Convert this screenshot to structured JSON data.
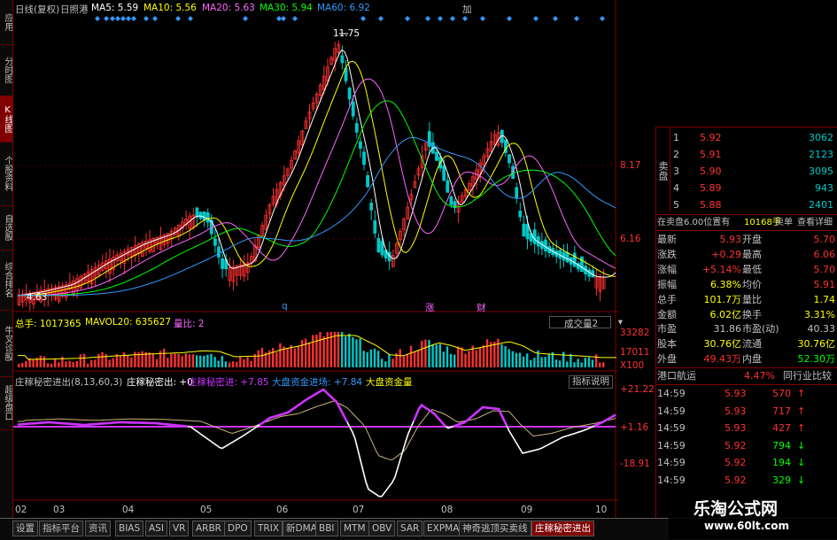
{
  "colors": {
    "up": "#ff3030",
    "down": "#00c8c8",
    "ma5": "#ffffff",
    "ma10": "#ffff00",
    "ma20": "#ff66ff",
    "ma30": "#00ff00",
    "ma60": "#3399ff",
    "axis": "#800000",
    "purple": "#cc33ff",
    "white": "#ffffff",
    "beige": "#c8b478"
  },
  "left_nav": [
    {
      "label": "应用",
      "active": false
    },
    {
      "label": "分时图",
      "active": false
    },
    {
      "label": "K线图",
      "active": true
    },
    {
      "label": "个股资料",
      "active": false
    },
    {
      "label": "自选股",
      "active": false
    },
    {
      "label": "综合排名",
      "active": false
    },
    {
      "label": "牛叉诊股",
      "active": false
    },
    {
      "label": "超级盘口",
      "active": false
    }
  ],
  "header": {
    "period": "日线(复权)",
    "stock": "日照港",
    "ma5": "MA5: 5.59",
    "ma10": "MA10: 5.56",
    "ma20": "MA20: 5.63",
    "ma30": "MA30: 5.94",
    "ma60": "MA60: 6.92",
    "add_btn": "加"
  },
  "kline": {
    "high_label": "11.75",
    "low_label": "4.63",
    "axis": [
      "8.17",
      "6.16"
    ],
    "markers": [
      "q",
      "涨",
      "财"
    ]
  },
  "volume": {
    "title": "总手: 1017365",
    "mavol": "MAVOL20: 635627",
    "ratio": "量比: 2",
    "selector": "成交量2",
    "axis": [
      "33282",
      "17011",
      "X100"
    ]
  },
  "indicator": {
    "name": "庄稼秘密进出(8,13,60,3)",
    "v1": "庄稼秘密出: +0",
    "v2": "庄稼秘密进: +7.85",
    "v3": "大盘资金进场: +7.84",
    "v4": "大盘资金量",
    "help": "指标说明",
    "axis": [
      "+21.22",
      "+1.16",
      "-18.91"
    ]
  },
  "time_axis": [
    "02",
    "03",
    "04",
    "05",
    "06",
    "07",
    "08",
    "09",
    "10"
  ],
  "order_book": {
    "sell_label": "卖盘",
    "sell": [
      {
        "n": "1",
        "p": "5.92",
        "v": "3062"
      },
      {
        "n": "2",
        "p": "5.91",
        "v": "2123"
      },
      {
        "n": "3",
        "p": "5.90",
        "v": "3095"
      },
      {
        "n": "4",
        "p": "5.89",
        "v": "943"
      },
      {
        "n": "5",
        "p": "5.88",
        "v": "2401"
      }
    ],
    "status_left": "在卖盘6.00位置有",
    "status_mid": "10168手",
    "status_sell": "卖单",
    "status_detail": "查看详细"
  },
  "quote": [
    {
      "k1": "最新",
      "v1": "5.93",
      "k2": "开盘",
      "v2": "5.70"
    },
    {
      "k1": "涨跌",
      "v1": "+0.29",
      "k2": "最高",
      "v2": "6.06"
    },
    {
      "k1": "涨幅",
      "v1": "+5.14%",
      "k2": "最低",
      "v2": "5.70"
    },
    {
      "k1": "振幅",
      "v1": "6.38%",
      "k2": "均价",
      "v2": "5.91"
    },
    {
      "k1": "总手",
      "v1": "101.7万",
      "k2": "量比",
      "v2": "1.74"
    },
    {
      "k1": "金额",
      "v1": "6.02亿",
      "k2": "换手",
      "v2": "3.31%"
    },
    {
      "k1": "市盈",
      "v1": "31.86",
      "k2": "市盈(动)",
      "v2": "40.33"
    },
    {
      "k1": "股本",
      "v1": "30.76亿",
      "k2": "流通",
      "v2": "30.76亿"
    },
    {
      "k1": "外盘",
      "v1": "49.43万",
      "k2": "内盘",
      "v2": "52.30万"
    }
  ],
  "sector": {
    "name": "港口航运",
    "pct": "4.47%",
    "compare": "同行业比较"
  },
  "ticks": [
    {
      "t": "14:59",
      "p": "5.93",
      "v": "570",
      "d": "up"
    },
    {
      "t": "14:59",
      "p": "5.93",
      "v": "717",
      "d": "up"
    },
    {
      "t": "14:59",
      "p": "5.93",
      "v": "427",
      "d": "up"
    },
    {
      "t": "14:59",
      "p": "5.92",
      "v": "794",
      "d": "down"
    },
    {
      "t": "14:59",
      "p": "5.92",
      "v": "194",
      "d": "down"
    },
    {
      "t": "14:59",
      "p": "5.92",
      "v": "329",
      "d": "down"
    }
  ],
  "tabs": [
    "设置",
    "指标平台",
    "资讯",
    "BIAS",
    "ASI",
    "VR",
    "ARBR",
    "DPO",
    "TRIX",
    "新DMA",
    "BBI",
    "MTM",
    "OBV",
    "SAR",
    "EXPMA",
    "神奇逃顶买卖线",
    "庄稼秘密进出"
  ],
  "watermark": {
    "cn": "乐淘公式网",
    "url": "www.60lt.com"
  }
}
